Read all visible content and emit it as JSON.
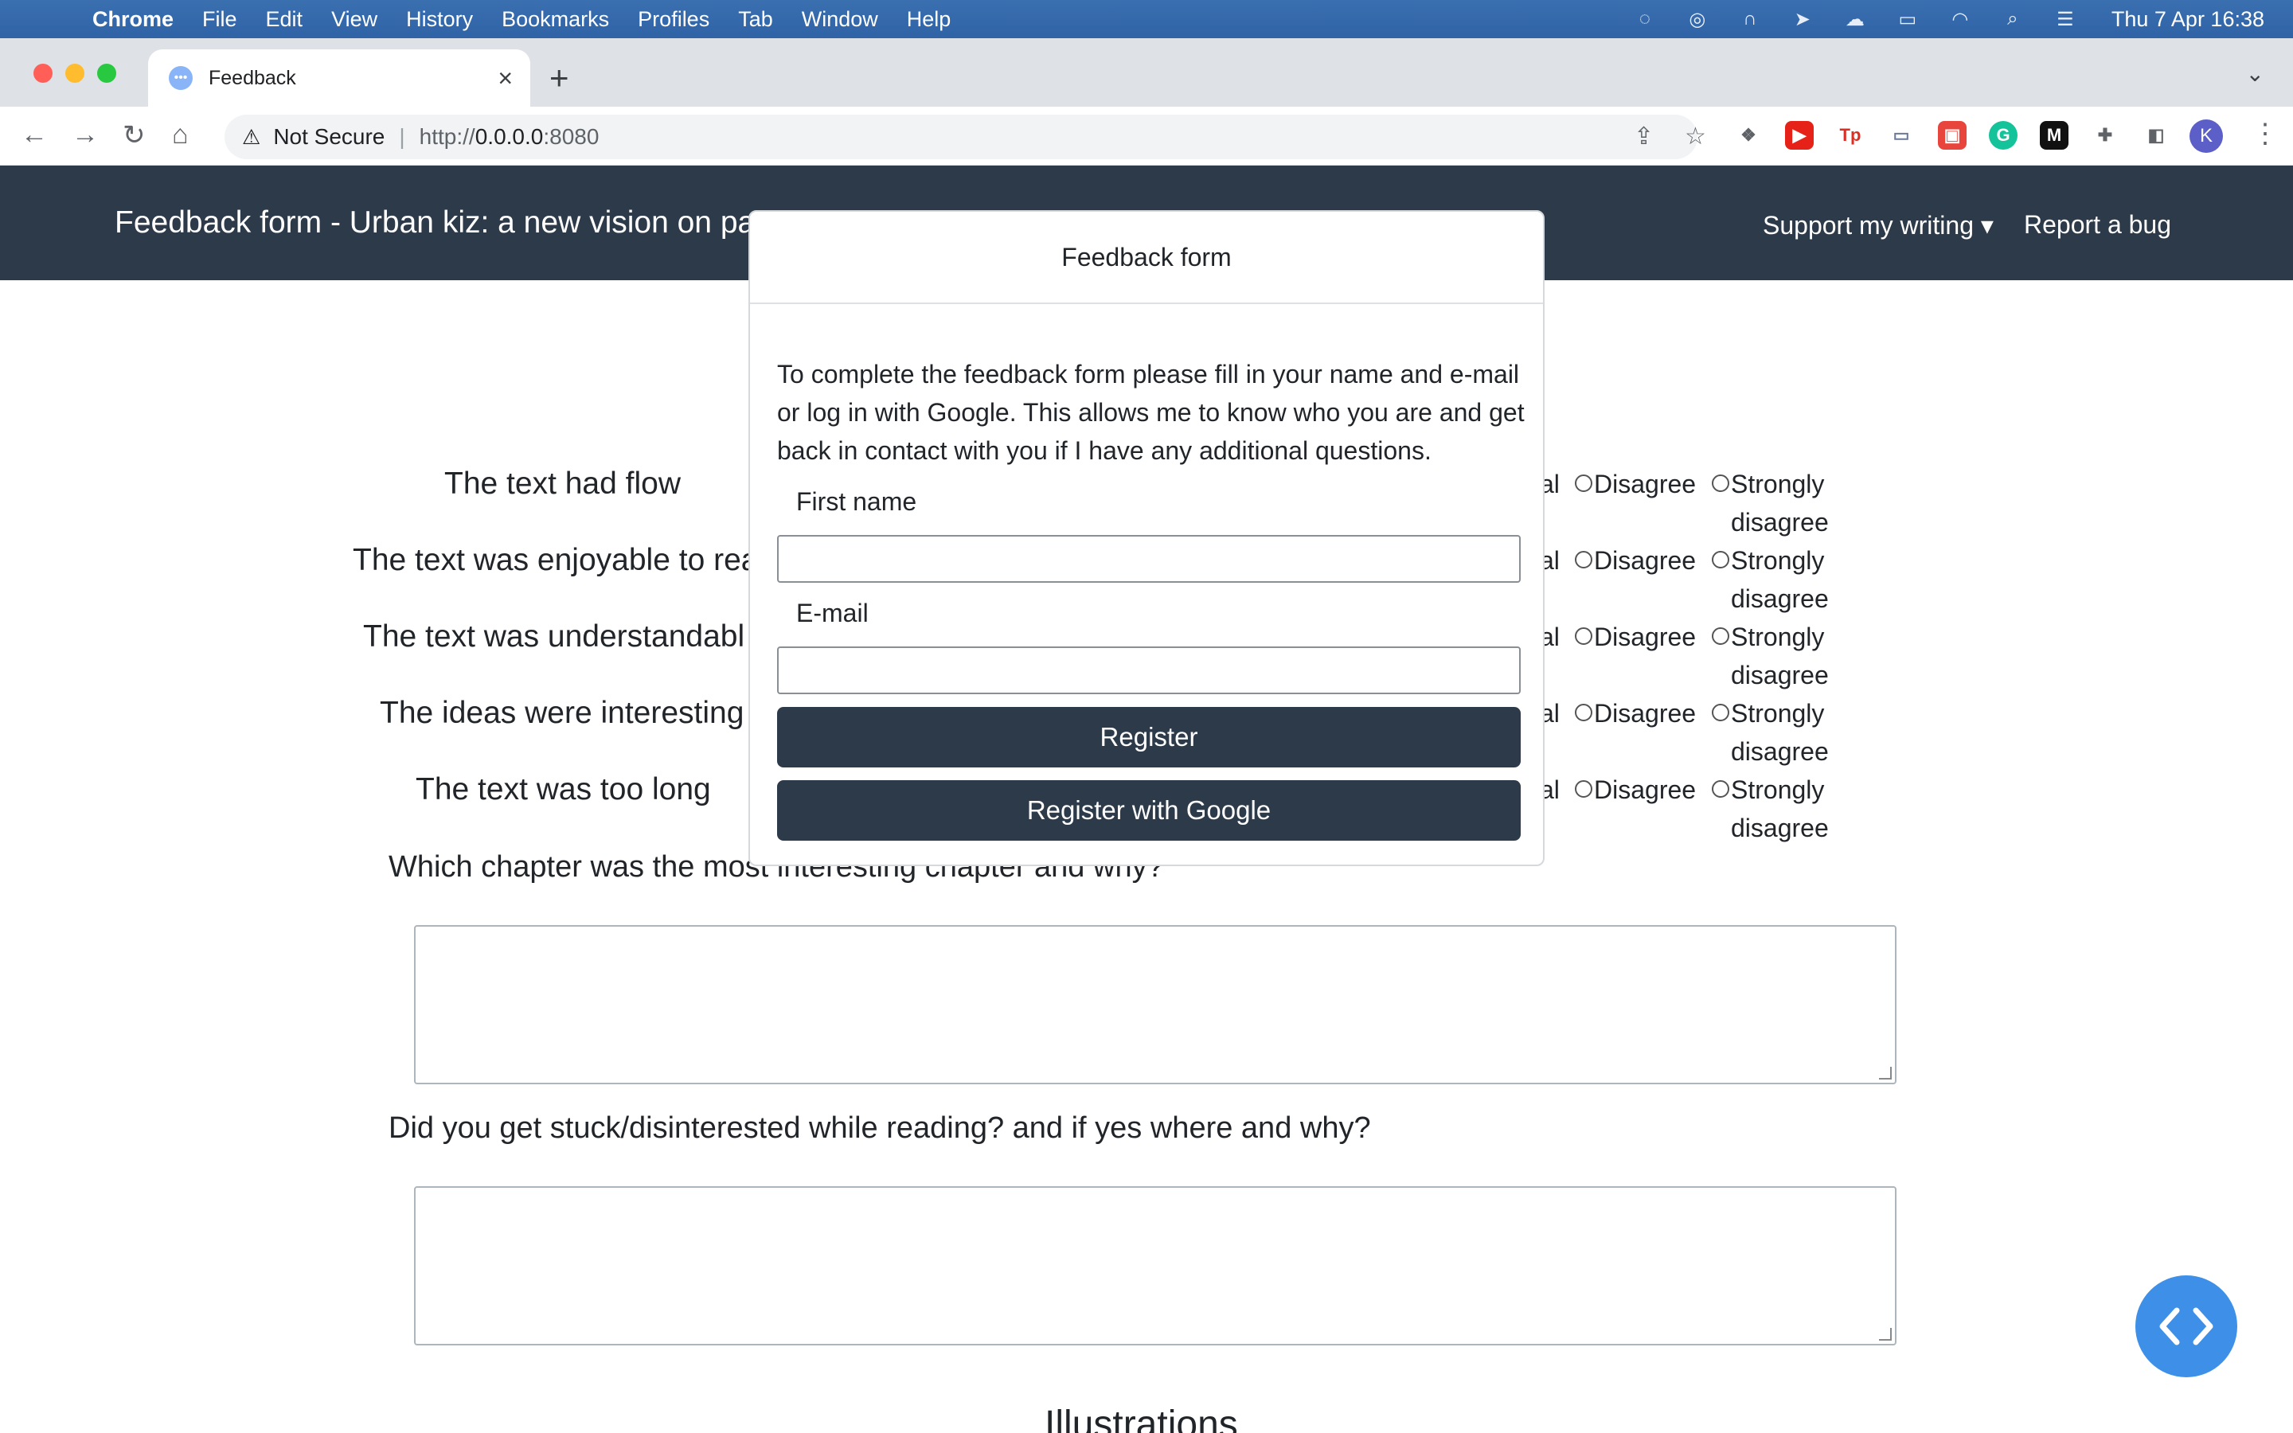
{
  "menubar": {
    "app": "Chrome",
    "items": [
      "File",
      "Edit",
      "View",
      "History",
      "Bookmarks",
      "Profiles",
      "Tab",
      "Window",
      "Help"
    ],
    "clock": "Thu 7 Apr  16:38"
  },
  "browser": {
    "tab_title": "Feedback",
    "security_label": "Not Secure",
    "url_prefix": "http://",
    "url_host": "0.0.0.0",
    "url_port": ":8080",
    "profile_initial": "K",
    "extensions": [
      {
        "name": "dropbox-icon",
        "color": "#5f6368",
        "glyph": "❖"
      },
      {
        "name": "youtube-icon",
        "color": "#e62117",
        "glyph": "▶"
      },
      {
        "name": "tp-icon",
        "color": "#d93025",
        "glyph": "Tp"
      },
      {
        "name": "screen-icon",
        "color": "#6b7a99",
        "glyph": "▭"
      },
      {
        "name": "red-app-icon",
        "color": "#e8453c",
        "glyph": "▣"
      },
      {
        "name": "grammarly-icon",
        "color": "#15c39a",
        "glyph": "G"
      },
      {
        "name": "medium-icon",
        "color": "#111111",
        "glyph": "M"
      },
      {
        "name": "puzzle-icon",
        "color": "#5f6368",
        "glyph": "✚"
      },
      {
        "name": "sidepanel-icon",
        "color": "#5f6368",
        "glyph": "◧"
      }
    ]
  },
  "site": {
    "brand": "Feedback form - Urban kiz: a new vision on par",
    "support": "Support my writing ▾",
    "bug": "Report a bug"
  },
  "statements": [
    "The text had flow",
    "The text was enjoyable to rea",
    "The text was understandabl",
    "The ideas were interesting",
    "The text was too long"
  ],
  "options": {
    "neutral_fragment": "al",
    "disagree": "Disagree",
    "strongly_1": "Strongly",
    "strongly_2": "disagree"
  },
  "questions": {
    "q1": "Which chapter was the most interesting chapter and why?",
    "q2": "Did you get stuck/disinterested while reading? and if yes where and why?",
    "section": "Illustrations"
  },
  "modal": {
    "title": "Feedback form",
    "message": "To complete the feedback form please fill in your name and e-mail or log in with Google. This allows me to know who you are and get back in contact with you if I have any additional questions.",
    "first_name_label": "First name",
    "email_label": "E-mail",
    "register": "Register",
    "register_google": "Register with Google"
  },
  "colors": {
    "navbar": "#2d3a4a",
    "button": "#2d3a4a",
    "fab": "#3d8fe8"
  }
}
